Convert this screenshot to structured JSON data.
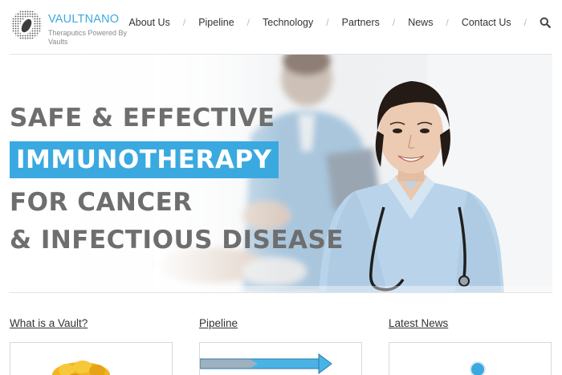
{
  "brand": {
    "name_part1": "VAULT",
    "name_part2": "NANO",
    "tagline": "Theraputics Powered By Vaults",
    "accent_color": "#3ea9de"
  },
  "nav": {
    "items": [
      "About Us",
      "Pipeline",
      "Technology",
      "Partners",
      "News",
      "Contact Us"
    ],
    "search_icon": "search-icon"
  },
  "hero": {
    "line1": "SAFE & EFFECTIVE",
    "line2": "IMMUNOTHERAPY",
    "line3": "FOR CANCER",
    "line4": "& INFECTIOUS DISEASE",
    "highlight_color": "#3aa9e0",
    "text_color": "#6e6e6e"
  },
  "columns": [
    {
      "title": "What is a Vault?"
    },
    {
      "title": "Pipeline"
    },
    {
      "title": "Latest News"
    }
  ]
}
